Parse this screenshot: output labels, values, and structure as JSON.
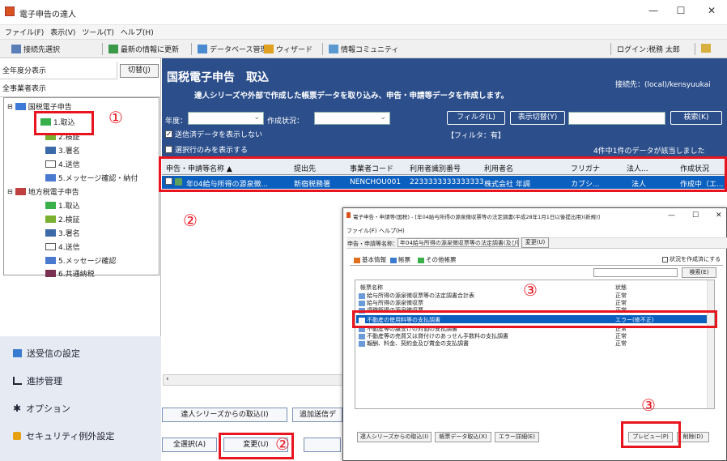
{
  "window": {
    "title": "電子申告の達人",
    "controls": [
      "—",
      "☐",
      "✕"
    ]
  },
  "menu": [
    "ファイル(F)",
    "表示(V)",
    "ツール(T)",
    "ヘルプ(H)"
  ],
  "toolbar": {
    "items": [
      "接続先選択",
      "最新の情報に更新",
      "データベース管理",
      "ウィザード",
      "情報コミュニティ"
    ],
    "login": "ログイン:税務 太郎"
  },
  "sidebar": {
    "year_all": "全年度分表示",
    "switch_btn": "切替(J)",
    "biz_all": "全事業者表示",
    "national": {
      "label": "国税電子申告",
      "items": [
        "1.取込",
        "2.検証",
        "3.署名",
        "4.送信",
        "5.メッセージ確認・納付"
      ]
    },
    "local": {
      "label": "地方税電子申告",
      "items": [
        "1.取込",
        "2.検証",
        "3.署名",
        "4.送信",
        "5.メッセージ確認",
        "6.共通納税"
      ]
    },
    "bottom": [
      "送受信の設定",
      "進捗管理",
      "オプション",
      "セキュリティ例外設定"
    ]
  },
  "header": {
    "title": "国税電子申告　取込",
    "subtitle": "達人シリーズや外部で作成した帳票データを取り込み、申告・申請等データを作成します。",
    "dest": "接続先：(local)/kensyuukai",
    "year_label": "年度：",
    "status_label": "作成状況：",
    "filter_btn": "フィルタ(L)",
    "display_btn": "表示切替(Y)",
    "search_btn": "検索(K)",
    "chk_sent": "送信済データを表示しない",
    "chk_selected": "選択行のみを表示する",
    "filter_state": "【フィルタ：有】",
    "count_text": "4件中1件のデータが該当しました"
  },
  "grid": {
    "columns": [
      "申告・申請等名称 ▲",
      "提出先",
      "事業者コード",
      "利用者識別番号",
      "利用者名",
      "フリガナ",
      "法人...",
      "作成状況"
    ],
    "rows": [
      [
        "年04給与所得の源泉徴...",
        "新宿税務署",
        "NENCHOU001",
        "2233333333333333",
        "株式会社 年調",
        "カブシ...",
        "法人",
        "作成中（エ..."
      ]
    ]
  },
  "bottom_buttons": {
    "import": "達人シリーズからの取込(I)",
    "add": "追加送信デ",
    "select_all": "全選択(A)",
    "change": "変更(U)"
  },
  "dialog": {
    "title": "電子申告・申請等(国税) - [年04給与所得の源泉徴収票等の法定調書(平成28年1月1日以後提出用)(新規)]",
    "menu": [
      "ファイル(F)",
      "ヘルプ(H)"
    ],
    "name_label": "申告・申請等名称：",
    "name_value": "年04給与所得の源泉徴収票等の法定調書(及び同",
    "change_btn": "変更(U)",
    "tabs": [
      "基本情報",
      "帳票",
      "その他帳票"
    ],
    "chk_status": "状況を作成済にする",
    "search_btn": "検索(E)",
    "list_headers": [
      "帳票名称",
      "状態"
    ],
    "list": [
      {
        "name": "給与所得の源泉徴収票等の法定調書合計表",
        "status": "正常"
      },
      {
        "name": "給与所得の源泉徴収票",
        "status": "正常"
      },
      {
        "name": "退職所得の源泉徴収票",
        "status": "正常"
      },
      {
        "name": "不動産の使用料等の支払調書",
        "status": "エラー(修不正)"
      },
      {
        "name": "不動産等の譲受けの対価の支払調書",
        "status": "正常"
      },
      {
        "name": "不動産等の売買又は貸付けのあっせん手数料の支払調書",
        "status": "正常"
      },
      {
        "name": "報酬、料金、契約金及び賞金の支払調書",
        "status": "正常"
      }
    ],
    "buttons": [
      "達人シリーズからの取込(I)",
      "帳票データ取込(X)",
      "エラー詳細(E)",
      "プレビュー(P)",
      "削除(D)"
    ]
  },
  "marks": [
    "①",
    "②",
    "②",
    "③",
    "③"
  ]
}
